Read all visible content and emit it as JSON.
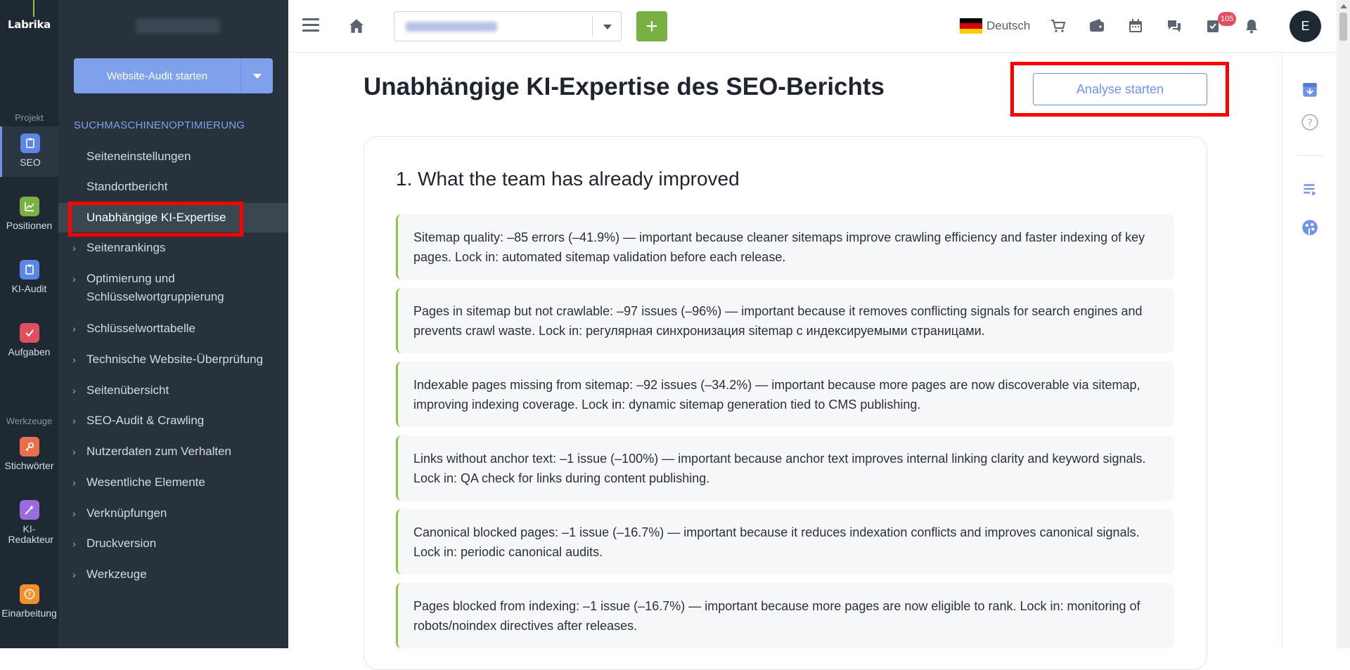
{
  "rail": {
    "logo": "Labrika",
    "section_project": "Projekt",
    "section_tools": "Werkzeuge",
    "items": [
      {
        "label": "SEO",
        "icon": "seo-icon",
        "color": "#5b86e5"
      },
      {
        "label": "Positionen",
        "icon": "chart-icon",
        "color": "#79b043"
      },
      {
        "label": "KI-Audit",
        "icon": "clipboard-icon",
        "color": "#5b86e5"
      },
      {
        "label": "Aufgaben",
        "icon": "check-icon",
        "color": "#e04f5f"
      },
      {
        "label": "Stichwörter",
        "icon": "key-icon",
        "color": "#e8704a"
      },
      {
        "label": "KI-Redakteur",
        "icon": "magic-wand-icon",
        "color": "#9a6bdc"
      },
      {
        "label": "Einarbeitung",
        "icon": "help-icon",
        "color": "#f0902c"
      }
    ]
  },
  "sidebar": {
    "audit_button": "Website-Audit starten",
    "heading": "SUCHMASCHINENOPTIMIERUNG",
    "items": [
      {
        "label": "Seiteneinstellungen"
      },
      {
        "label": "Standortbericht"
      },
      {
        "label": "Unabhängige KI-Expertise"
      },
      {
        "label": "Seitenrankings"
      },
      {
        "label": "Optimierung und Schlüsselwortgruppierung"
      },
      {
        "label": "Schlüsselworttabelle"
      },
      {
        "label": "Technische Website-Überprüfung"
      },
      {
        "label": "Seitenübersicht"
      },
      {
        "label": "SEO-Audit & Crawling"
      },
      {
        "label": "Nutzerdaten zum Verhalten"
      },
      {
        "label": "Wesentliche Elemente"
      },
      {
        "label": "Verknüpfungen"
      },
      {
        "label": "Druckversion"
      },
      {
        "label": "Werkzeuge"
      }
    ]
  },
  "topbar": {
    "add_label": "+",
    "language": "Deutsch",
    "notification_count": "105",
    "avatar_initial": "E"
  },
  "main": {
    "title": "Unabhängige KI-Expertise des SEO-Berichts",
    "analyse_button": "Analyse starten",
    "section_title": "1. What the team has already improved",
    "entries": [
      {
        "text": "Sitemap quality: –85 errors (–41.9%) — important because cleaner sitemaps improve crawling efficiency and faster indexing of key pages. Lock in: automated sitemap validation before each release."
      },
      {
        "text": "Pages in sitemap but not crawlable: –97 issues (–96%) — important because it removes conflicting signals for search engines and prevents crawl waste. Lock in: регулярная синхронизация sitemap с индексируемыми страницами."
      },
      {
        "text": "Indexable pages missing from sitemap: –92 issues (–34.2%) — important because more pages are now discoverable via sitemap, improving indexing coverage. Lock in: dynamic sitemap generation tied to CMS publishing."
      },
      {
        "text": "Links without anchor text: –1 issue (–100%) — important because anchor text improves internal linking clarity and keyword signals. Lock in: QA check for links during content publishing."
      },
      {
        "text": "Canonical blocked pages: –1 issue (–16.7%) — important because it reduces indexation conflicts and improves canonical signals. Lock in: periodic canonical audits."
      },
      {
        "text": "Pages blocked from indexing: –1 issue (–16.7%) — important because more pages are now eligible to rank. Lock in: monitoring of robots/noindex directives after releases."
      }
    ]
  },
  "colors": {
    "accent_blue": "#6f93ea",
    "accent_green": "#8dc63f",
    "highlight_red": "#ff0000",
    "sidebar_dark": "#27323c"
  }
}
